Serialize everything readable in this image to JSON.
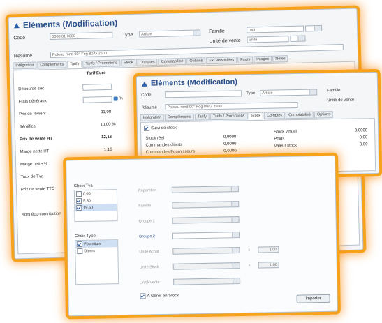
{
  "window_main": {
    "title": "Eléments (Modification)",
    "code_label": "Code",
    "code_value": "0000 01 0000",
    "type_label": "Type",
    "type_value": "Article",
    "famille_label": "Famille",
    "famille_value": "tout",
    "resume_label": "Résumé",
    "resume_value": "Poteau rond 90° Fog 80/G 2500",
    "unite_label": "Unité de vente",
    "unite_value": "unité",
    "tabs": [
      "Intégration",
      "Compléments",
      "Tarify",
      "Tarifs / Promotions",
      "Stock",
      "Comptes",
      "Comptabilisé",
      "Options",
      "Ext. Associées",
      "Fours",
      "Images",
      "Notes"
    ],
    "col_header": "Tarif Euro",
    "rows": [
      {
        "label": "Déboursé sec",
        "value": ""
      },
      {
        "label": "Frais généraux",
        "value": ""
      },
      {
        "label": "Prix de revient",
        "value": "11,00"
      },
      {
        "label": "Bénéfice",
        "value": "10,00 %"
      },
      {
        "label": "Prix de vente HT",
        "value": "12,16"
      },
      {
        "label": "Marge nette HT",
        "value": "1,16"
      },
      {
        "label": "Marge nette %",
        "value": ""
      },
      {
        "label": "Taux de Tva",
        "value": ""
      },
      {
        "label": "Prix de vente TTC",
        "value": ""
      },
      {
        "label": "Kont éco-contribution",
        "value": ""
      }
    ],
    "percent_sign": "%"
  },
  "window_stock": {
    "title": "Eléments (Modification)",
    "code_label": "Code",
    "type_label": "Type",
    "type_value": "Article",
    "famille_label": "Famille",
    "resume_label": "Résumé",
    "resume_value": "Poteau rond 90° Fog 80/G 2500",
    "unite_label": "Unité de vente",
    "tabs": [
      "Intégration",
      "Compléments",
      "Tarify",
      "Tarifs / Promotions",
      "Stock",
      "Comptes",
      "Comptabilisé",
      "Options"
    ],
    "section_checkbox": "Suivi de stock",
    "left_rows": [
      {
        "label": "Stock réel",
        "value": "0,0000"
      },
      {
        "label": "Commandes clients",
        "value": "0,0000"
      },
      {
        "label": "Commandes Fournisseurs",
        "value": "0,0000"
      }
    ],
    "right_rows": [
      {
        "label": "Stock virtuel",
        "value": "0,0000"
      },
      {
        "label": "Poids",
        "value": "0,00"
      },
      {
        "label": "Valeur stock",
        "value": "0,00"
      }
    ]
  },
  "window_dialog": {
    "group1_title": "Choix Tva",
    "tva_options": [
      {
        "label": "0,00",
        "checked": false
      },
      {
        "label": "5,50",
        "checked": true
      },
      {
        "label": "19,60",
        "checked": true
      }
    ],
    "group2_title": "Choix Type",
    "type_options": [
      {
        "label": "Fourniture",
        "checked": true
      },
      {
        "label": "Divers",
        "checked": false
      }
    ],
    "field_labels": [
      "Répartition",
      "Famille",
      "Groupe 1",
      "Groupe 2",
      "Unité Achat",
      "Unité Stock",
      "Unité Vente"
    ],
    "coef_sign": "x",
    "coef_value_1": "1,00",
    "coef_value_2": "1,00",
    "stock_checkbox": "A Gérer en Stock",
    "import_button": "Importer"
  },
  "colors": {
    "glow": "#f7a21b",
    "title_blue": "#2a4f8a"
  }
}
